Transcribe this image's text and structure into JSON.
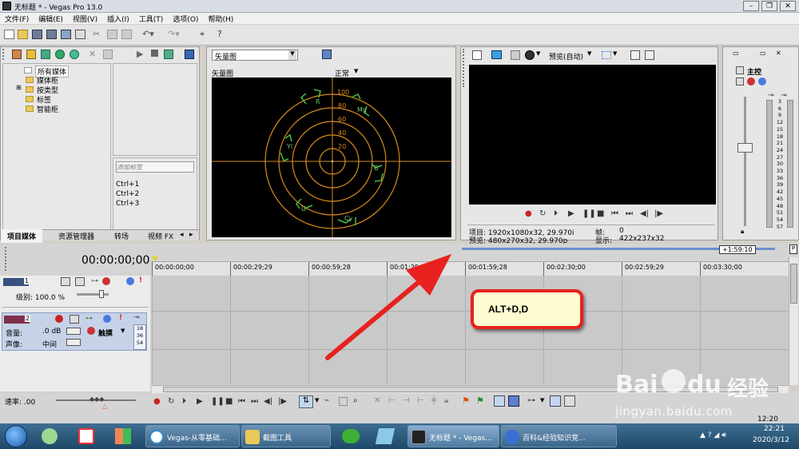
{
  "window": {
    "title": "无标题 * - Vegas Pro 13.0"
  },
  "menu": [
    "文件(F)",
    "编辑(E)",
    "视图(V)",
    "插入(I)",
    "工具(T)",
    "选项(O)",
    "帮助(H)"
  ],
  "explorer": {
    "items": [
      "所有媒体",
      "媒体柜",
      "按类型",
      "标签",
      "智能柜"
    ],
    "tag_placeholder": "添加标签",
    "shortcuts": [
      "Ctrl+1",
      "Ctrl+2",
      "Ctrl+3"
    ],
    "tabs": [
      "项目媒体",
      "资源管理器",
      "转场",
      "视频 FX"
    ]
  },
  "scope": {
    "dropdown": "矢量图",
    "label": "矢量图",
    "mode": "正常",
    "rings": [
      "100",
      "80",
      "60",
      "40",
      "20"
    ],
    "targets": [
      "R",
      "Mg",
      "B",
      "Cy",
      "G",
      "Yl"
    ]
  },
  "preview": {
    "quality": "预览(自动)",
    "info": {
      "project": "项目: 1920x1080x32, 29.970i",
      "preview": "预览: 480x270x32, 29.970p",
      "frame_label": "帧:",
      "frame": "0",
      "display_label": "显示:",
      "display": "422x237x32"
    }
  },
  "master": {
    "label": "主控",
    "top_values": [
      "-∞",
      "-∞"
    ],
    "scale": [
      "3",
      "6",
      "9",
      "12",
      "15",
      "18",
      "21",
      "24",
      "27",
      "30",
      "33",
      "36",
      "39",
      "42",
      "45",
      "48",
      "51",
      "54",
      "57"
    ]
  },
  "timeline": {
    "timecode": "00:00:00;00",
    "marker": "+1:59:10",
    "ruler": [
      "00:00:00;00",
      "00:00:29;29",
      "00:00:59;28",
      "00:01:29;29",
      "00:01:59;28",
      "00:02:30;00",
      "00:02:59;29",
      "00:03:30;00"
    ],
    "video_track": {
      "number": "1",
      "level": "级别: 100.0 %"
    },
    "audio_track": {
      "number": "2",
      "volume_label": "音量:",
      "volume": ".0 dB",
      "pan_label": "声像:",
      "pan": "中间",
      "mode": "触摸",
      "meter": [
        "18",
        "36",
        "54"
      ],
      "meter_top": "-∞"
    },
    "rate": "速率: .00",
    "end_time": "12:20"
  },
  "annotation": {
    "callout": "ALT+D,D",
    "arrow_color": "#e8221e"
  },
  "taskbar": {
    "buttons": [
      "Vegas-从零基础...",
      "截图工具",
      "",
      "",
      "无标题 * - Vegas...",
      "百科&经验知识竞..."
    ],
    "clock_time": "22:21",
    "clock_date": "2020/3/12"
  },
  "watermark": {
    "brand": "Bai",
    "du": "du",
    "cn": "经验",
    "url": "jingyan.baidu.com"
  },
  "colors": {
    "accent": "#e8221e",
    "scope_ring": "#d88b1c",
    "scope_text": "#7ac47a",
    "taskbar": "#2b5678"
  }
}
